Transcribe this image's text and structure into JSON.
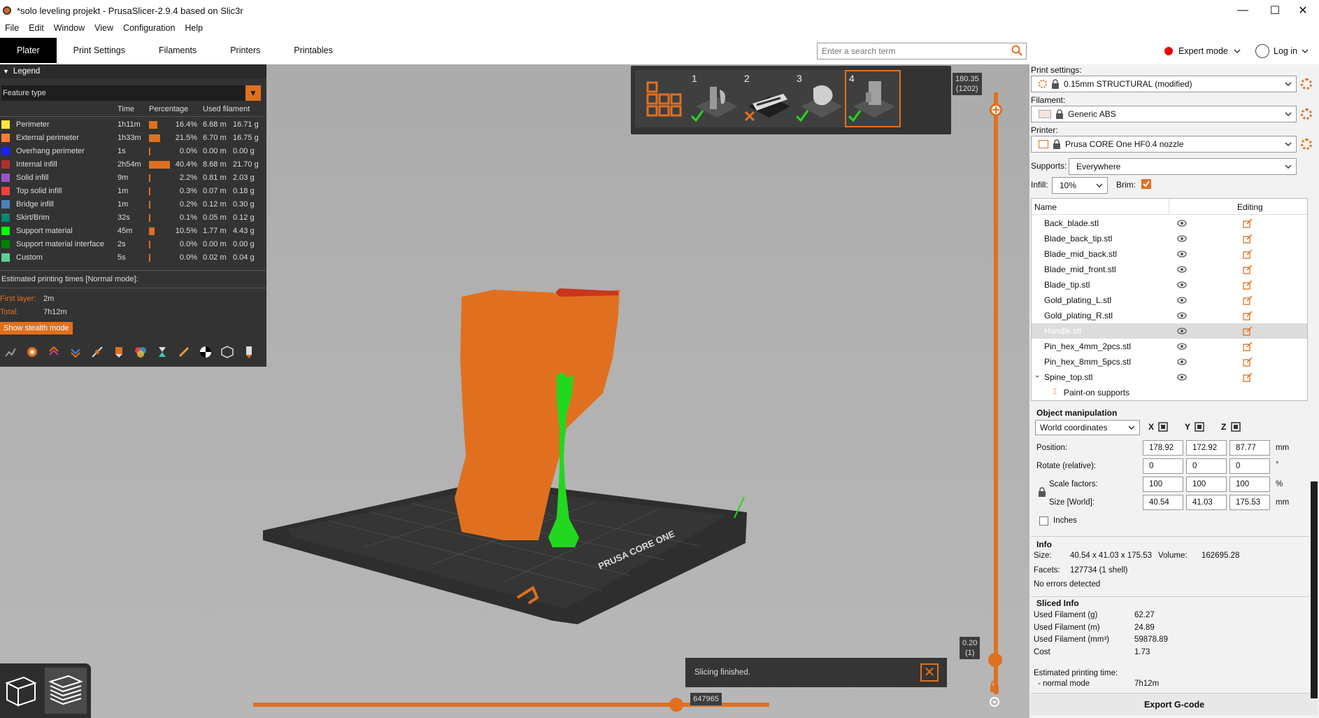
{
  "window": {
    "title": "*solo leveling projekt - PrusaSlicer-2.9.4 based on Slic3r",
    "minimize": "—",
    "maximize": "☐",
    "close": "✕"
  },
  "menu": [
    "File",
    "Edit",
    "Window",
    "View",
    "Configuration",
    "Help"
  ],
  "tabs": [
    "Plater",
    "Print Settings",
    "Filaments",
    "Printers",
    "Printables"
  ],
  "search": {
    "placeholder": "Enter a search term"
  },
  "mode": {
    "label": "Expert mode",
    "color": "#e00000"
  },
  "login": {
    "label": "Log in"
  },
  "legend": {
    "title": "Legend",
    "view_type": "Feature type",
    "columns": [
      "Time",
      "Percentage",
      "Used filament"
    ],
    "rows": [
      {
        "name": "Perimeter",
        "color": "#ffe640",
        "time": "1h11m",
        "pct": "16.4%",
        "pct_value": 16.4,
        "length": "6.68 m",
        "weight": "16.71 g"
      },
      {
        "name": "External perimeter",
        "color": "#ff7d38",
        "time": "1h33m",
        "pct": "21.5%",
        "pct_value": 21.5,
        "length": "6.70 m",
        "weight": "16.75 g"
      },
      {
        "name": "Overhang perimeter",
        "color": "#1f1fff",
        "time": "1s",
        "pct": "0.0%",
        "pct_value": 0.0,
        "length": "0.00 m",
        "weight": "0.00 g"
      },
      {
        "name": "Internal infill",
        "color": "#b03029",
        "time": "2h54m",
        "pct": "40.4%",
        "pct_value": 40.4,
        "length": "8.68 m",
        "weight": "21.70 g"
      },
      {
        "name": "Solid infill",
        "color": "#9654cc",
        "time": "9m",
        "pct": "2.2%",
        "pct_value": 2.2,
        "length": "0.81 m",
        "weight": "2.03 g"
      },
      {
        "name": "Top solid infill",
        "color": "#f04040",
        "time": "1m",
        "pct": "0.3%",
        "pct_value": 0.3,
        "length": "0.07 m",
        "weight": "0.18 g"
      },
      {
        "name": "Bridge infill",
        "color": "#4d80ba",
        "time": "1m",
        "pct": "0.2%",
        "pct_value": 0.2,
        "length": "0.12 m",
        "weight": "0.30 g"
      },
      {
        "name": "Skirt/Brim",
        "color": "#00876e",
        "time": "32s",
        "pct": "0.1%",
        "pct_value": 0.1,
        "length": "0.05 m",
        "weight": "0.12 g"
      },
      {
        "name": "Support material",
        "color": "#00ff00",
        "time": "45m",
        "pct": "10.5%",
        "pct_value": 10.5,
        "length": "1.77 m",
        "weight": "4.43 g"
      },
      {
        "name": "Support material interface",
        "color": "#008000",
        "time": "2s",
        "pct": "0.0%",
        "pct_value": 0.0,
        "length": "0.00 m",
        "weight": "0.00 g"
      },
      {
        "name": "Custom",
        "color": "#5ed194",
        "time": "5s",
        "pct": "0.0%",
        "pct_value": 0.0,
        "length": "0.02 m",
        "weight": "0.04 g"
      }
    ],
    "estimated_title": "Estimated printing times [Normal mode]:",
    "first_layer_label": "First layer:",
    "first_layer": "2m",
    "total_label": "Total:",
    "total": "7h12m",
    "stealth_button": "Show stealth mode"
  },
  "plates": [
    {
      "num": "",
      "status": ""
    },
    {
      "num": "1",
      "status": "ok"
    },
    {
      "num": "2",
      "status": "error"
    },
    {
      "num": "3",
      "status": "ok"
    },
    {
      "num": "4",
      "status": "ok"
    }
  ],
  "vslider": {
    "top_value": "180.35",
    "top_layer": "(1202)",
    "bottom_value": "0.20",
    "bottom_layer": "(1)"
  },
  "hslider": {
    "value": "647965",
    "position": 0.82
  },
  "notification": {
    "text": "Slicing finished."
  },
  "colors": {
    "accent": "#e0701f",
    "model": "#e0701f",
    "support": "#22d81e"
  },
  "right": {
    "print_settings_label": "Print settings:",
    "print_settings": "0.15mm STRUCTURAL (modified)",
    "filament_label": "Filament:",
    "filament": "Generic ABS",
    "printer_label": "Printer:",
    "printer": "Prusa CORE One HF0.4 nozzle",
    "supports_label": "Supports:",
    "supports": "Everywhere",
    "infill_label": "Infill:",
    "infill": "10%",
    "brim_label": "Brim:",
    "brim": true,
    "list_header_name": "Name",
    "list_header_editing": "Editing",
    "objects": [
      {
        "name": "Back_blade.stl"
      },
      {
        "name": "Blade_back_tip.stl"
      },
      {
        "name": "Blade_mid_back.stl"
      },
      {
        "name": "Blade_mid_front.stl"
      },
      {
        "name": "Blade_tip.stl"
      },
      {
        "name": "Gold_plating_L.stl"
      },
      {
        "name": "Gold_plating_R.stl"
      },
      {
        "name": "Handle.stl",
        "selected": true
      },
      {
        "name": "Pin_hex_4mm_2pcs.stl"
      },
      {
        "name": "Pin_hex_8mm_5pcs.stl"
      },
      {
        "name": "Spine_top.stl",
        "expanded": true
      }
    ],
    "sub_item": "Paint-on supports",
    "manip_title": "Object manipulation",
    "coord_mode": "World coordinates",
    "axes": [
      "X",
      "Y",
      "Z"
    ],
    "position_label": "Position:",
    "position": [
      "178.92",
      "172.92",
      "87.77"
    ],
    "position_unit": "mm",
    "rotate_label": "Rotate (relative):",
    "rotate": [
      "0",
      "0",
      "0"
    ],
    "rotate_unit": "°",
    "scale_label": "Scale factors:",
    "scale": [
      "100",
      "100",
      "100"
    ],
    "scale_unit": "%",
    "size_label": "Size [World]:",
    "size": [
      "40.54",
      "41.03",
      "175.53"
    ],
    "size_unit": "mm",
    "inches_label": "Inches",
    "info_title": "Info",
    "info_size_label": "Size:",
    "info_size": "40.54 x 41.03 x 175.53",
    "info_volume_label": "Volume:",
    "info_volume": "162695.28",
    "info_facets_label": "Facets:",
    "info_facets": "127734 (1 shell)",
    "info_errors": "No errors detected",
    "sliced_title": "Sliced Info",
    "sliced": [
      {
        "label": "Used Filament (g)",
        "value": "62.27"
      },
      {
        "label": "Used Filament (m)",
        "value": "24.89"
      },
      {
        "label": "Used Filament (mm³)",
        "value": "59878.89"
      },
      {
        "label": "Cost",
        "value": "1.73"
      }
    ],
    "est_time_label": "Estimated printing time:",
    "normal_mode_label": "- normal mode",
    "normal_mode_value": "7h12m",
    "export_button": "Export G-code"
  }
}
